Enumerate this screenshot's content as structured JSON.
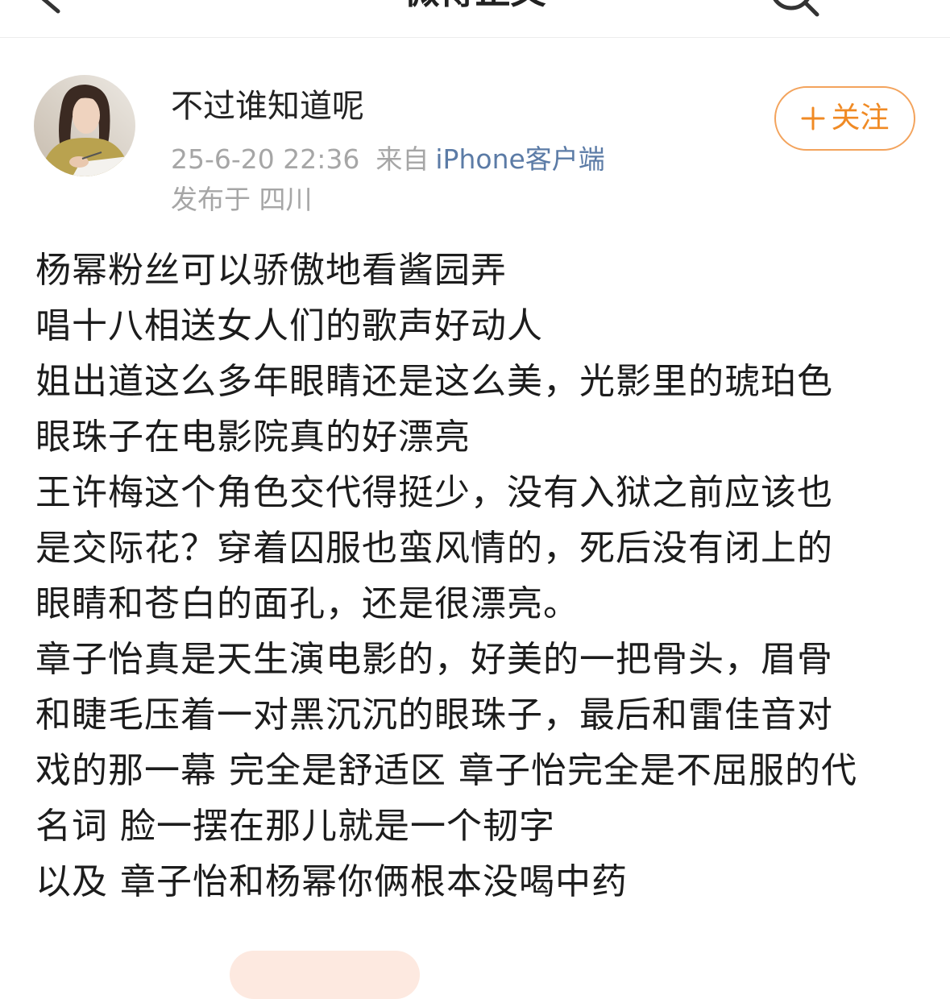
{
  "nav": {
    "back_icon": "chevron-left-icon",
    "title": "微博正文",
    "search_icon": "search-icon"
  },
  "post": {
    "author": {
      "name": "不过谁知道呢"
    },
    "follow_button": {
      "icon": "plus-icon",
      "label": "关注"
    },
    "meta": {
      "time": "25-6-20 22:36",
      "source_prefix": "来自",
      "source": "iPhone客户端",
      "location": "发布于 四川"
    },
    "lines": [
      "杨幂粉丝可以骄傲地看酱园弄",
      "唱十八相送女人们的歌声好动人",
      "姐出道这么多年眼睛还是这么美，光影里的琥珀色",
      "眼珠子在电影院真的好漂亮",
      "王许梅这个角色交代得挺少，没有入狱之前应该也",
      "是交际花？穿着囚服也蛮风情的，死后没有闭上的",
      "眼睛和苍白的面孔，还是很漂亮。",
      "章子怡真是天生演电影的，好美的一把骨头，眉骨",
      "和睫毛压着一对黑沉沉的眼珠子，最后和雷佳音对",
      "戏的那一幕 完全是舒适区 章子怡完全是不屈服的代",
      "名词 脸一摆在那儿就是一个韧字",
      "以及 章子怡和杨幂你俩根本没喝中药"
    ]
  },
  "theme": {
    "accent": "#f08a24",
    "accent_border": "#f3a35c",
    "link": "#5b7ba6",
    "text": "#1c1c1c",
    "meta": "#a6a6a6",
    "card": "#fde9e0"
  }
}
